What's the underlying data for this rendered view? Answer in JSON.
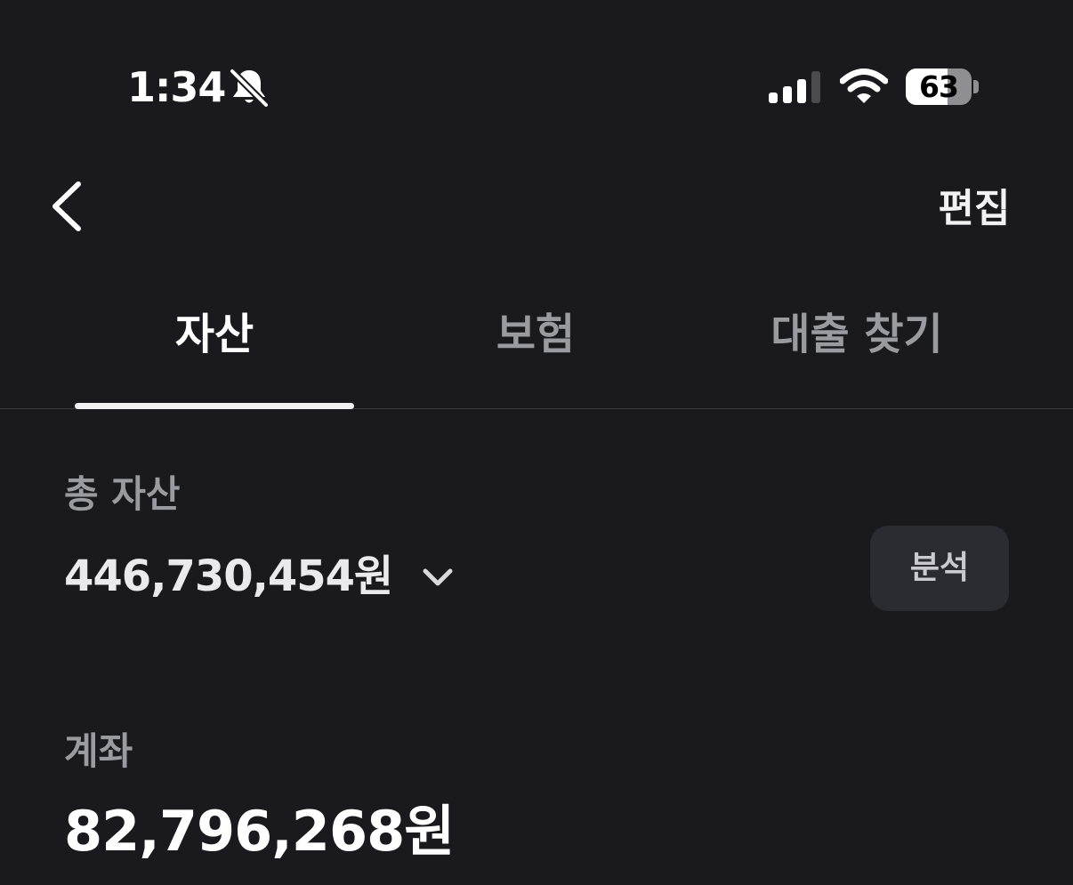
{
  "status_bar": {
    "time": "1:34",
    "battery_level": 63,
    "battery_text": "63",
    "icons": [
      "bell-slash-icon",
      "cellular-signal-icon",
      "wifi-icon",
      "battery-icon"
    ]
  },
  "nav": {
    "back_icon": "chevron-left-icon",
    "edit_label": "편집"
  },
  "tabs": [
    {
      "label": "자산",
      "active": true
    },
    {
      "label": "보험",
      "active": false
    },
    {
      "label": "대출 찾기",
      "active": false
    }
  ],
  "total_assets": {
    "label": "총 자산",
    "value": "446,730,454원",
    "expand_icon": "chevron-down-icon",
    "analysis_label": "분석"
  },
  "accounts": {
    "label": "계좌",
    "value": "82,796,268원"
  },
  "colors": {
    "background": "#19191e",
    "active_tab": "#ffffff",
    "inactive_tab": "#9a9aa1",
    "secondary_text": "#9a9aa1",
    "button_bg": "#2b2c32"
  }
}
